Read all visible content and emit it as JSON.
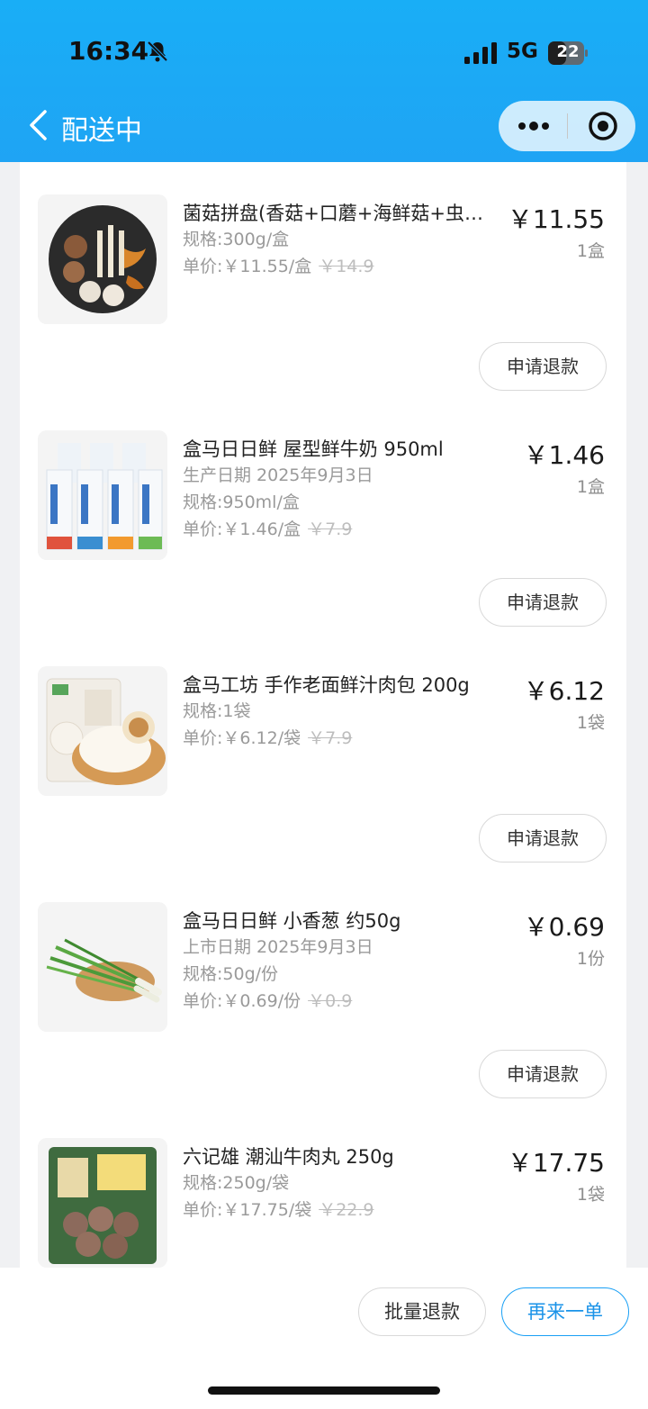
{
  "status": {
    "time": "16:34",
    "network": "5G",
    "battery": "22"
  },
  "nav": {
    "title": "配送中"
  },
  "items": [
    {
      "name": "菌菇拼盘(香菇+口蘑+海鲜菇+虫草花)",
      "lines": [
        "规格:300g/盒"
      ],
      "unit": "单价:￥11.55/盒",
      "orig": "￥14.9",
      "price": "￥11.55",
      "qty": "1盒",
      "refund": "申请退款"
    },
    {
      "name": "盒马日日鲜 屋型鲜牛奶 950ml",
      "lines": [
        "生产日期 2025年9月3日",
        "规格:950ml/盒"
      ],
      "unit": "单价:￥1.46/盒",
      "orig": "￥7.9",
      "price": "￥1.46",
      "qty": "1盒",
      "refund": "申请退款"
    },
    {
      "name": "盒马工坊 手作老面鲜汁肉包 200g",
      "lines": [
        "规格:1袋"
      ],
      "unit": "单价:￥6.12/袋",
      "orig": "￥7.9",
      "price": "￥6.12",
      "qty": "1袋",
      "refund": "申请退款"
    },
    {
      "name": "盒马日日鲜 小香葱 约50g",
      "lines": [
        "上市日期 2025年9月3日",
        "规格:50g/份"
      ],
      "unit": "单价:￥0.69/份",
      "orig": "￥0.9",
      "price": "￥0.69",
      "qty": "1份",
      "refund": "申请退款"
    },
    {
      "name": "六记雄 潮汕牛肉丸 250g",
      "lines": [
        "规格:250g/袋"
      ],
      "unit": "单价:￥17.75/袋",
      "orig": "￥22.9",
      "price": "￥17.75",
      "qty": "1袋"
    }
  ],
  "footer": {
    "batch_refund": "批量退款",
    "reorder": "再来一单"
  },
  "colors": {
    "header": "#1fa4f4",
    "accent": "#1a93e8"
  }
}
